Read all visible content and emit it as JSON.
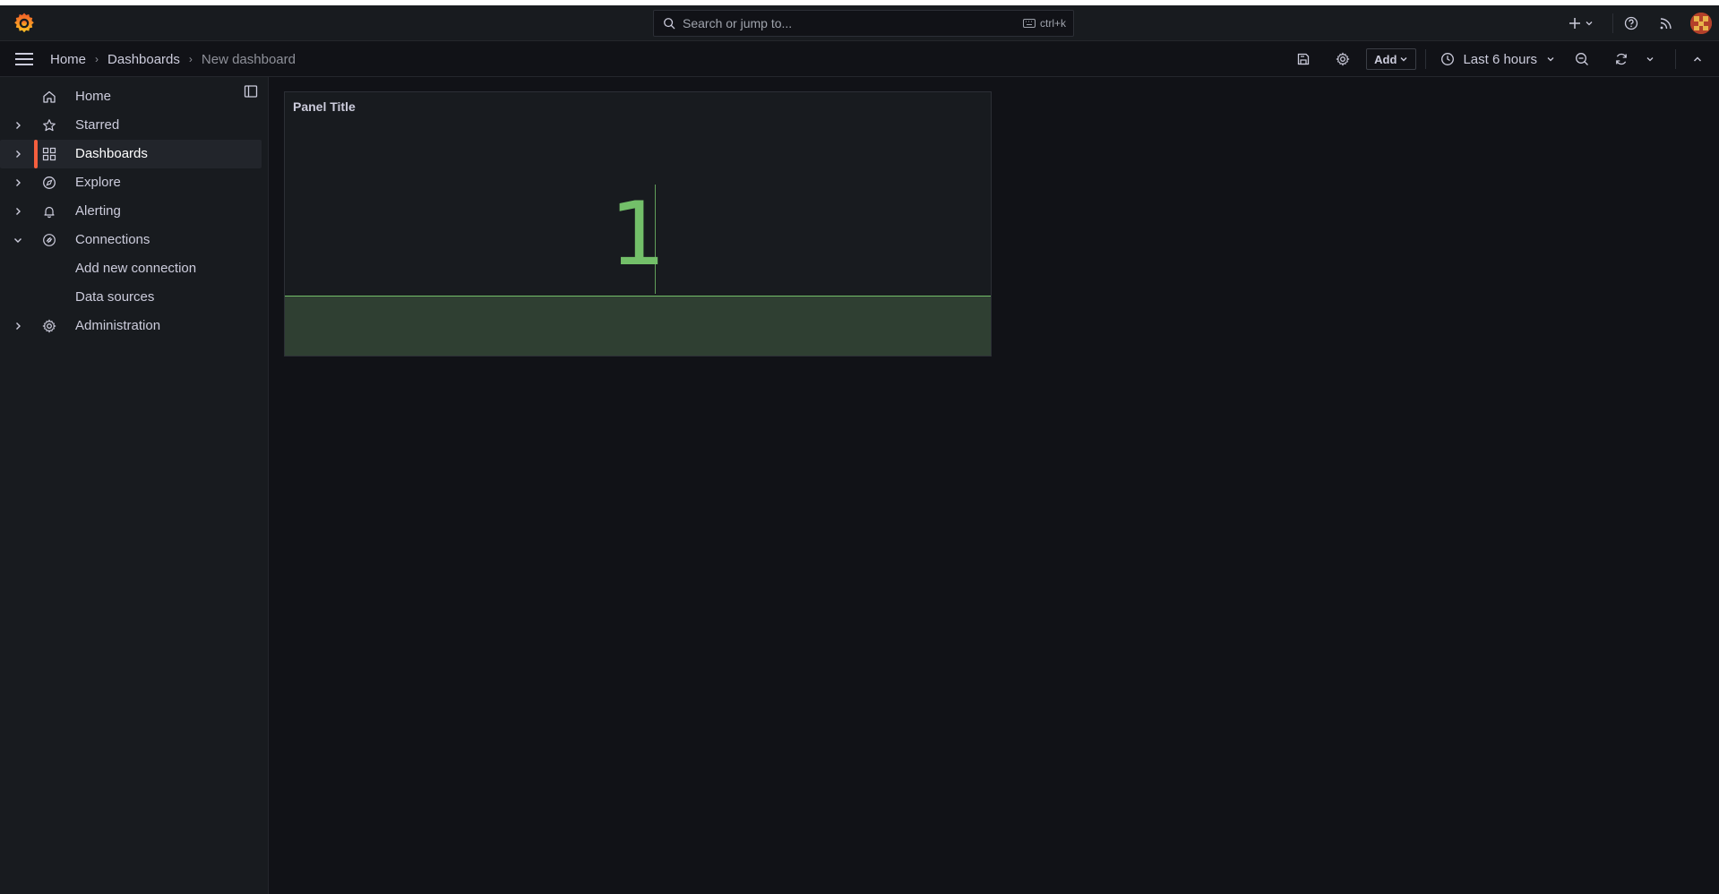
{
  "topbar": {
    "logo_icon": "grafana-logo-icon",
    "search": {
      "placeholder": "Search or jump to...",
      "shortcut": "ctrl+k"
    },
    "new_icon": "plus-icon",
    "help_icon": "help-icon",
    "news_icon": "rss-icon",
    "profile_icon": "avatar"
  },
  "breadcrumbs": [
    "Home",
    "Dashboards",
    "New dashboard"
  ],
  "toolbar": {
    "save_icon": "save-icon",
    "settings_icon": "gear-icon",
    "add_label": "Add",
    "time_range": "Last 6 hours",
    "zoom_icon": "zoom-out-icon",
    "refresh_icon": "refresh-icon",
    "collapse_icon": "chevron-up-icon"
  },
  "sidebar": {
    "items": [
      {
        "label": "Home",
        "icon": "home-icon",
        "chevron": "none"
      },
      {
        "label": "Starred",
        "icon": "star-icon",
        "chevron": "right"
      },
      {
        "label": "Dashboards",
        "icon": "apps-icon",
        "chevron": "right",
        "active": true
      },
      {
        "label": "Explore",
        "icon": "compass-icon",
        "chevron": "right"
      },
      {
        "label": "Alerting",
        "icon": "bell-icon",
        "chevron": "right"
      },
      {
        "label": "Connections",
        "icon": "link-icon",
        "chevron": "down"
      },
      {
        "label": "Add new connection",
        "icon": "",
        "chevron": "none"
      },
      {
        "label": "Data sources",
        "icon": "",
        "chevron": "none"
      },
      {
        "label": "Administration",
        "icon": "gear-icon",
        "chevron": "right"
      }
    ]
  },
  "panel": {
    "title": "Panel Title",
    "value": "1",
    "value_color": "#73bf69"
  },
  "colors": {
    "accent": "#f55f3e",
    "background": "#111217",
    "surface": "#181b1f"
  }
}
